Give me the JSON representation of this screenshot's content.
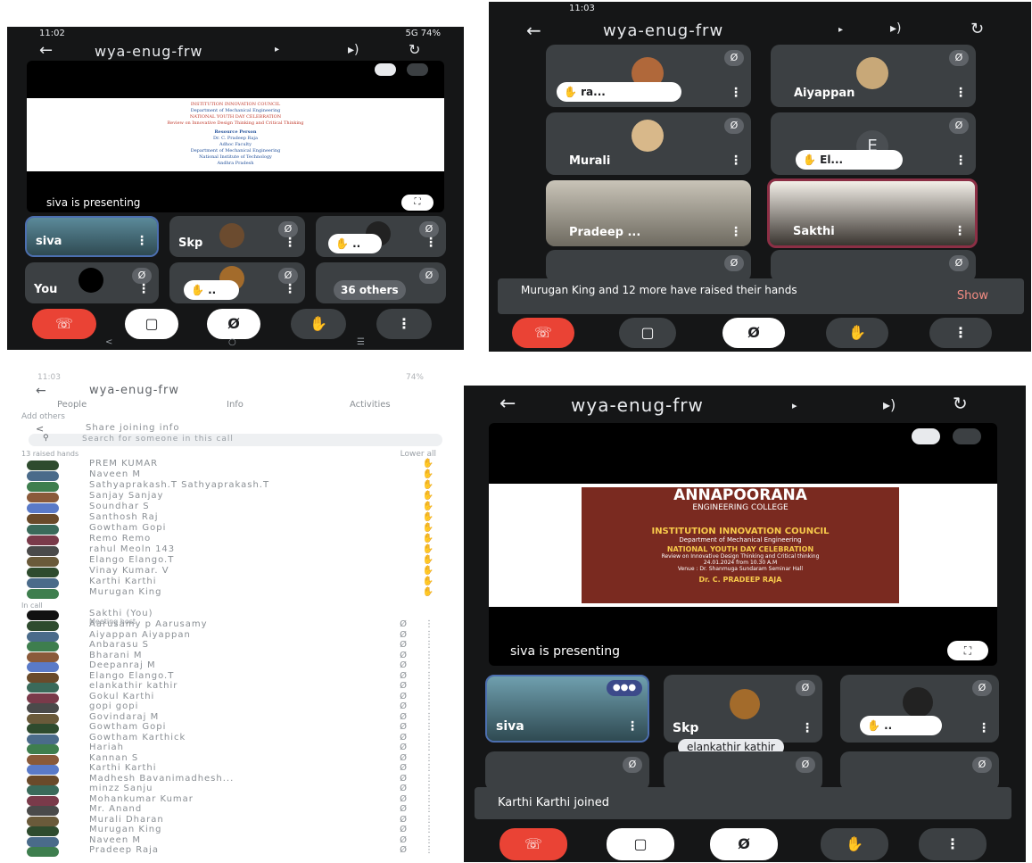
{
  "panel1": {
    "status_time": "11:02",
    "status_right": "5G 74%",
    "meeting_code": "wya-enug-frw",
    "slide_lines": [
      "INSTITUTION INNOVATION COUNCIL",
      "Department of Mechanical Engineering",
      "NATIONAL YOUTH DAY CELEBRATION",
      "Review on Innovative Design Thinking and Critical Thinking",
      "Resource Person",
      "Dr. C. Pradeep Raja",
      "Adhoc Faculty",
      "Department of Mechanical Engineering",
      "National Institute of Technology",
      "Andhra Pradesh"
    ],
    "presenting_label": "siva is presenting",
    "tiles": [
      {
        "name": "siva"
      },
      {
        "name": "Skp"
      },
      {
        "name": ""
      },
      {
        "name": "You"
      },
      {
        "name": ""
      },
      {
        "name": "36 others"
      }
    ]
  },
  "panel2": {
    "status_time": "11:03",
    "meeting_code": "wya-enug-frw",
    "tiles": [
      {
        "name": "ra..."
      },
      {
        "name": "Aiyappan"
      },
      {
        "name": "Murali"
      },
      {
        "name": "El...",
        "initial": "E"
      },
      {
        "name": "Pradeep ..."
      },
      {
        "name": "Sakthi"
      }
    ],
    "toast_text": "Murugan King and 12 more have raised their hands",
    "toast_action": "Show"
  },
  "panel3": {
    "status_time": "11:03",
    "status_right": "74%",
    "meeting_code": "wya-enug-frw",
    "tabs": [
      "People",
      "Info",
      "Activities"
    ],
    "add_others": "Add others",
    "share_label": "Share joining info",
    "search_placeholder": "Search for someone in this call",
    "raised_header": "13 raised hands",
    "lower_all": "Lower all",
    "raised": [
      "PREM KUMAR",
      "Naveen M",
      "Sathyaprakash.T Sathyaprakash.T",
      "Sanjay Sanjay",
      "Soundhar S",
      "Santhosh Raj",
      "Gowtham Gopi",
      "Remo Remo",
      "rahul Meoln 143",
      "Elango Elango.T",
      "Vinay Kumar. V",
      "Karthi Karthi",
      "Murugan King"
    ],
    "in_call_header": "In call",
    "host_name": "Sakthi (You)",
    "host_role": "Meeting host",
    "in_call": [
      "Aarusamy p Aarusamy",
      "Aiyappan Aiyappan",
      "Anbarasu S",
      "Bharani M",
      "Deepanraj M",
      "Elango Elango.T",
      "elankathir kathir",
      "Gokul Karthi",
      "gopi gopi",
      "Govindaraj M",
      "Gowtham Gopi",
      "Gowtham Karthick",
      "Hariah",
      "Kannan S",
      "Karthi Karthi",
      "Madhesh Bavanimadhesh...",
      "minzz Sanju",
      "Mohankumar Kumar",
      "Mr. Anand",
      "Murali Dharan",
      "Murugan King",
      "Naveen M",
      "Pradeep Raja"
    ]
  },
  "panel4": {
    "meeting_code": "wya-enug-frw",
    "poster_title": "ANNAPOORANA",
    "poster_sub": "ENGINEERING COLLEGE",
    "poster_lines": [
      "INSTITUTION INNOVATION COUNCIL",
      "Department of Mechanical Engineering",
      "NATIONAL YOUTH DAY CELEBRATION",
      "Review on Innovative Design Thinking and Critical thinking",
      "24.01.2024 from 10.30 A.M",
      "Venue : Dr. Shanmuga Sundaram Seminar Hall",
      "Dr. C. PRADEEP RAJA"
    ],
    "presenting_label": "siva is presenting",
    "tiles": [
      {
        "name": "siva"
      },
      {
        "name": "Skp"
      },
      {
        "name": ""
      }
    ],
    "tooltip": "elankathir kathir",
    "toast_text": "Karthi Karthi joined"
  }
}
